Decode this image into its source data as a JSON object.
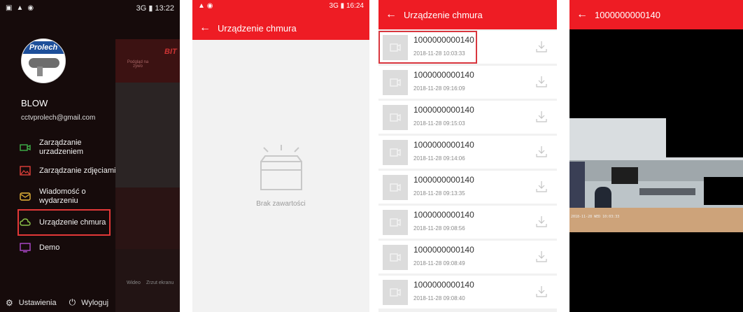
{
  "drawer": {
    "status": {
      "time": "13:22",
      "network": "3G"
    },
    "avatar_brand": "Prolech",
    "username": "BLOW",
    "email": "cctvprolech@gmail.com",
    "menu": [
      {
        "label": "Zarządzanie urzadzeniem",
        "icon": "camera-icon"
      },
      {
        "label": "Zarządzanie zdjęciami",
        "icon": "image-icon"
      },
      {
        "label": "Wiadomość o wydarzeniu",
        "icon": "message-icon"
      },
      {
        "label": "Urządzenie chmura",
        "icon": "cloud-icon"
      },
      {
        "label": "Demo",
        "icon": "demo-icon"
      }
    ],
    "footer": {
      "settings": "Ustawienia",
      "logout": "Wyloguj"
    },
    "background_app": {
      "brand": "BIT",
      "tab": "Podgląd na żywo",
      "video": "Wideo",
      "snapshot": "Zrzut ekranu"
    }
  },
  "cloud_empty": {
    "status": {
      "time": "16:24",
      "network": "3G"
    },
    "title": "Urządzenie chmura",
    "empty_label": "Brak zawartości"
  },
  "cloud_list": {
    "title": "Urządzenie chmura",
    "items": [
      {
        "name": "1000000000140",
        "date": "2018-11-28 10:03:33"
      },
      {
        "name": "1000000000140",
        "date": "2018-11-28 09:16:09"
      },
      {
        "name": "1000000000140",
        "date": "2018-11-28 09:15:03"
      },
      {
        "name": "1000000000140",
        "date": "2018-11-28 09:14:06"
      },
      {
        "name": "1000000000140",
        "date": "2018-11-28 09:13:35"
      },
      {
        "name": "1000000000140",
        "date": "2018-11-28 09:08:56"
      },
      {
        "name": "1000000000140",
        "date": "2018-11-28 09:08:49"
      },
      {
        "name": "1000000000140",
        "date": "2018-11-28 09:08:40"
      }
    ]
  },
  "player": {
    "title": "1000000000140",
    "overlay_text": "2018-11-28 WED 10:03:33"
  },
  "colors": {
    "accent_red": "#ee1c24",
    "highlight": "#e23838"
  }
}
